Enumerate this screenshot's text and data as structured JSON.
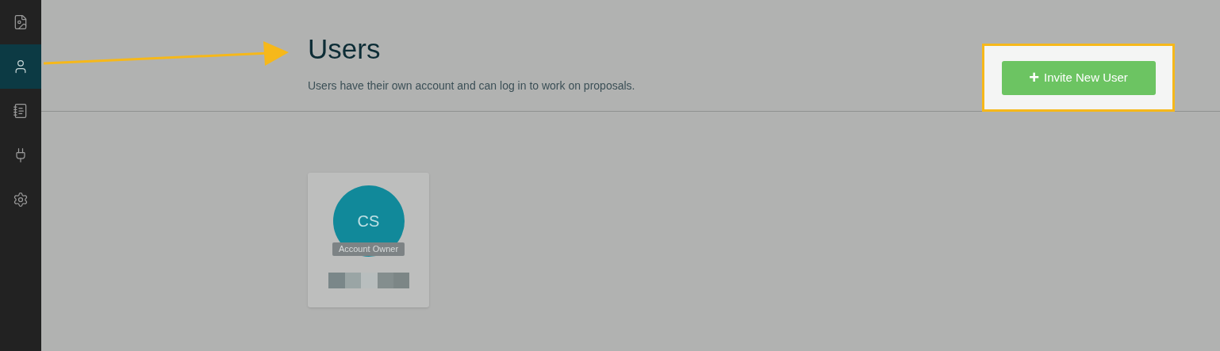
{
  "sidebar": {
    "items": [
      {
        "selected": false
      },
      {
        "selected": true
      },
      {
        "selected": false
      },
      {
        "selected": false
      },
      {
        "selected": false
      }
    ]
  },
  "header": {
    "title": "Users",
    "subtitle": "Users have their own account and can log in to work on proposals.",
    "invite_button": {
      "icon": "+",
      "label": "Invite New User",
      "highlighted": true
    }
  },
  "users": [
    {
      "initials": "CS",
      "badge": "Account Owner"
    }
  ]
}
